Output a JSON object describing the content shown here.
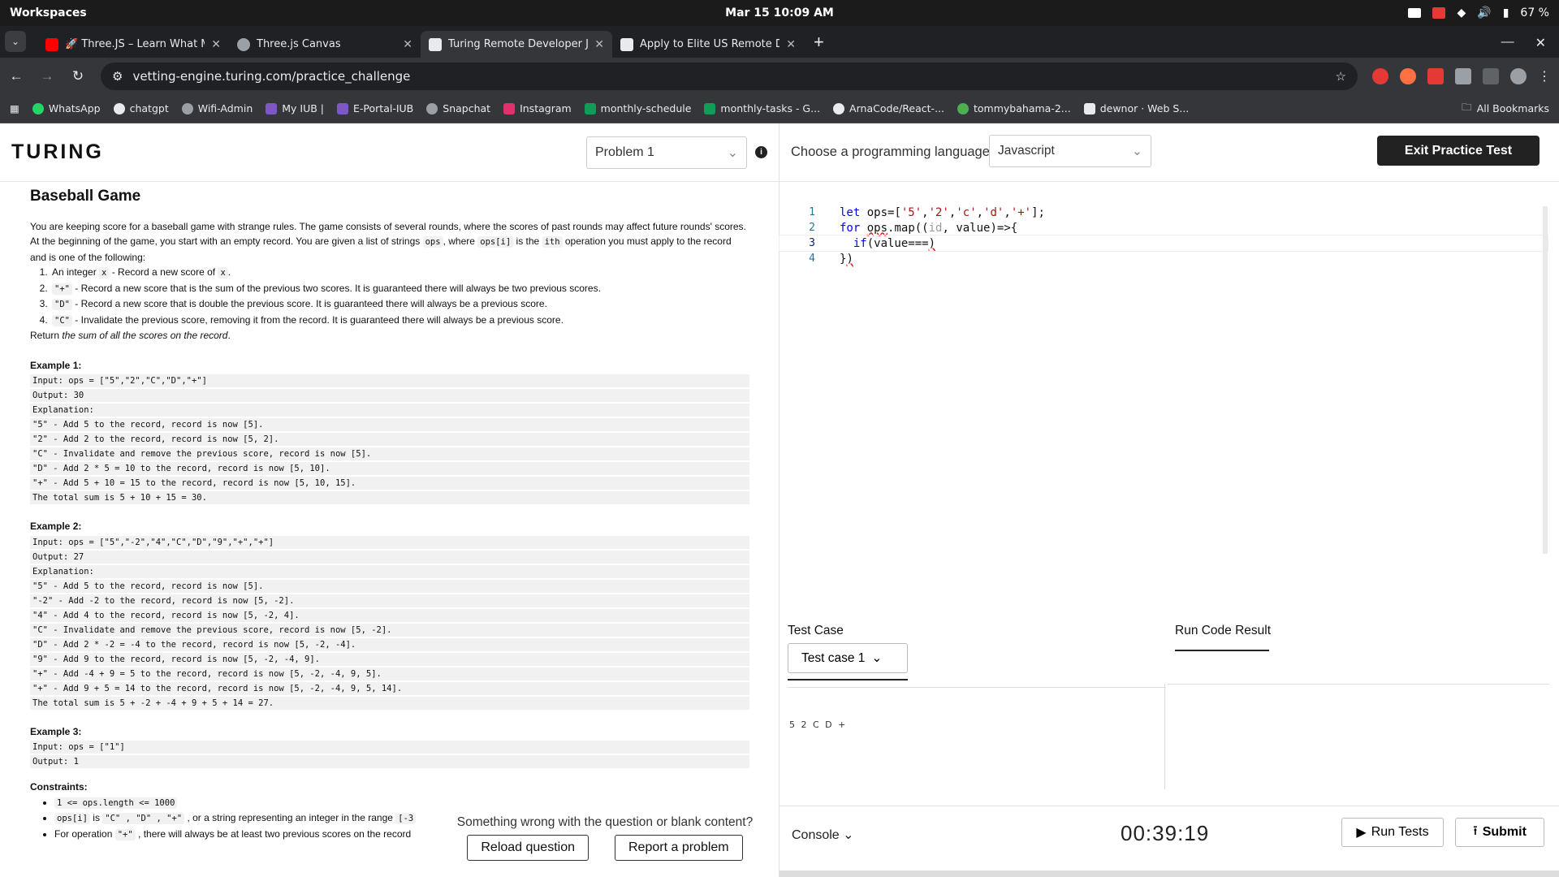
{
  "system": {
    "workspaces": "Workspaces",
    "clock": "Mar 15  10:09 AM",
    "battery": "67 %"
  },
  "tabs": [
    {
      "title": "🚀 Three.JS – Learn What Ma",
      "favicon_color": "#ff0000"
    },
    {
      "title": "Three.js Canvas",
      "favicon_color": "#9aa0a6"
    },
    {
      "title": "Turing Remote Developer Jo",
      "favicon_color": "#e8eaed"
    },
    {
      "title": "Apply to Elite US Remote De",
      "favicon_color": "#e8eaed"
    }
  ],
  "address": {
    "url": "vetting-engine.turing.com/practice_challenge"
  },
  "bookmarks": [
    {
      "label": "WhatsApp",
      "color": "#25d366"
    },
    {
      "label": "chatgpt",
      "color": "#e8eaed"
    },
    {
      "label": "Wifi-Admin",
      "color": "#9aa0a6"
    },
    {
      "label": "My IUB |",
      "color": "#7e57c2"
    },
    {
      "label": "E-Portal-IUB",
      "color": "#7e57c2"
    },
    {
      "label": "Snapchat",
      "color": "#9aa0a6"
    },
    {
      "label": "Instagram",
      "color": "#e1306c"
    },
    {
      "label": "monthly-schedule",
      "color": "#0f9d58"
    },
    {
      "label": "monthly-tasks - G...",
      "color": "#0f9d58"
    },
    {
      "label": "ArnaCode/React-...",
      "color": "#e8eaed"
    },
    {
      "label": "tommybahama-2...",
      "color": "#4caf50"
    },
    {
      "label": "dewnor · Web S...",
      "color": "#e8eaed"
    }
  ],
  "all_bookmarks": "All Bookmarks",
  "app": {
    "logo": "TURING",
    "problem_select": "Problem 1",
    "lang_label": "Choose a programming language",
    "lang_value": "Javascript",
    "exit_label": "Exit Practice Test"
  },
  "problem": {
    "title": "Baseball Game",
    "intro1": "You are keeping score for a baseball game with strange rules. The game consists of several rounds, where the scores of past rounds may affect future rounds' scores.",
    "intro2a": "At the beginning of the game, you start with an empty record. You are given a list of strings ",
    "intro2_code1": "ops",
    "intro2b": ", where ",
    "intro2_code2": "ops[i]",
    "intro2c": " is the ",
    "intro2_code3": "ith",
    "intro2d": " operation you must apply to the record and is one of the following:",
    "rules": [
      {
        "pre": "An integer ",
        "code": "x",
        "post": " - Record a new score of ",
        "code2": "x",
        "post2": "."
      },
      {
        "pre": "",
        "code": "\"+\"",
        "post": " - Record a new score that is the sum of the previous two scores. It is guaranteed there will always be two previous scores.",
        "code2": "",
        "post2": ""
      },
      {
        "pre": "",
        "code": "\"D\"",
        "post": " - Record a new score that is double the previous score. It is guaranteed there will always be a previous score.",
        "code2": "",
        "post2": ""
      },
      {
        "pre": "",
        "code": "\"C\"",
        "post": " - Invalidate the previous score, removing it from the record. It is guaranteed there will always be a previous score.",
        "code2": "",
        "post2": ""
      }
    ],
    "return_pre": "Return ",
    "return_em": "the sum of all the scores on the record",
    "return_post": ".",
    "examples": [
      {
        "title": "Example 1:",
        "lines": [
          "Input: ops = [\"5\",\"2\",\"C\",\"D\",\"+\"]",
          "Output: 30",
          "Explanation:",
          "\"5\" - Add 5 to the record, record is now [5].",
          "\"2\" - Add 2 to the record, record is now [5, 2].",
          "\"C\" - Invalidate and remove the previous score, record is now [5].",
          "\"D\" - Add 2 * 5 = 10 to the record, record is now [5, 10].",
          "\"+\" - Add 5 + 10 = 15 to the record, record is now [5, 10, 15].",
          "The total sum is 5 + 10 + 15 = 30."
        ]
      },
      {
        "title": "Example 2:",
        "lines": [
          "Input: ops = [\"5\",\"-2\",\"4\",\"C\",\"D\",\"9\",\"+\",\"+\"]",
          "Output: 27",
          "Explanation:",
          "\"5\" - Add 5 to the record, record is now [5].",
          "\"-2\" - Add -2 to the record, record is now [5, -2].",
          "\"4\" - Add 4 to the record, record is now [5, -2, 4].",
          "\"C\" - Invalidate and remove the previous score, record is now [5, -2].",
          "\"D\" - Add 2 * -2 = -4 to the record, record is now [5, -2, -4].",
          "\"9\" - Add 9 to the record, record is now [5, -2, -4, 9].",
          "\"+\" - Add -4 + 9 = 5 to the record, record is now [5, -2, -4, 9, 5].",
          "\"+\" - Add 9 + 5 = 14 to the record, record is now [5, -2, -4, 9, 5, 14].",
          "The total sum is 5 + -2 + -4 + 9 + 5 + 14 = 27."
        ]
      },
      {
        "title": "Example 3:",
        "lines": [
          "Input: ops = [\"1\"]",
          "Output: 1"
        ]
      }
    ],
    "constraints_title": "Constraints:",
    "c1": "1 <= ops.length <= 1000",
    "c2_code": "ops[i]",
    "c2_mid": " is ",
    "c2_codes": "\"C\" , \"D\" , \"+\"",
    "c2_post": " , or a string representing an integer in the range ",
    "c2_range": "[-3",
    "c3_pre": "For operation ",
    "c3_code": "\"+\"",
    "c3_post": " , there will always be at least two previous scores on the record"
  },
  "feedback": {
    "text": "Something wrong with the question or blank content?",
    "reload": "Reload question",
    "report": "Report a problem"
  },
  "editor": {
    "line_numbers": [
      "1",
      "2",
      "3",
      "4"
    ]
  },
  "test": {
    "title": "Test Case",
    "case": "Test case 1",
    "value": "5 2 C D +",
    "result_title": "Run Code Result"
  },
  "footer": {
    "console": "Console",
    "timer": "00:39:19",
    "run": "Run Tests",
    "submit": "Submit"
  }
}
